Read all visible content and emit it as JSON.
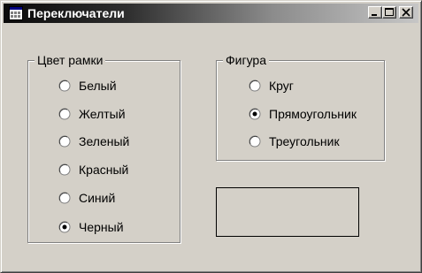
{
  "window": {
    "title": "Переключатели",
    "icon": "app-window-icon",
    "controls": [
      "minimize-icon",
      "maximize-icon",
      "close-icon"
    ]
  },
  "frame_color_group": {
    "label": "Цвет рамки",
    "options": [
      {
        "label": "Белый",
        "checked": false
      },
      {
        "label": "Желтый",
        "checked": false
      },
      {
        "label": "Зеленый",
        "checked": false
      },
      {
        "label": "Красный",
        "checked": false
      },
      {
        "label": "Синий",
        "checked": false
      },
      {
        "label": "Черный",
        "checked": true
      }
    ]
  },
  "shape_group": {
    "label": "Фигура",
    "options": [
      {
        "label": "Круг",
        "checked": false
      },
      {
        "label": "Прямоугольник",
        "checked": true
      },
      {
        "label": "Треугольник",
        "checked": false
      }
    ]
  },
  "preview": {
    "shape": "rectangle",
    "border_color": "#000000"
  },
  "colors": {
    "window_background": "#d4d0c8",
    "titlebar_start": "#0a0a0a",
    "titlebar_end": "#c6c6c6"
  }
}
